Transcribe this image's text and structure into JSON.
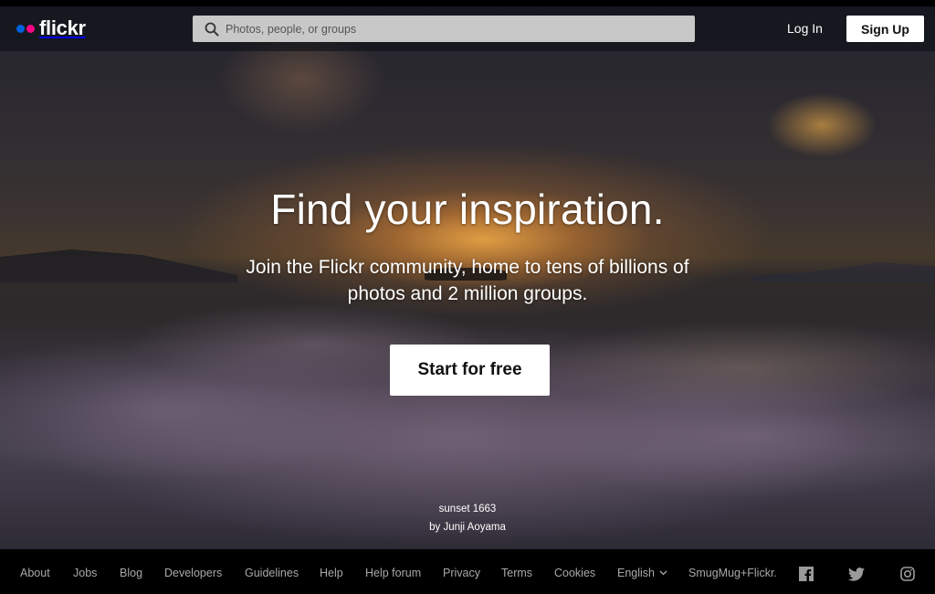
{
  "brand": {
    "name": "flickr",
    "dot_colors": [
      "#0063dc",
      "#ff0084"
    ]
  },
  "header": {
    "search_placeholder": "Photos, people, or groups",
    "search_icon": "search-icon",
    "login_label": "Log In",
    "signup_label": "Sign Up"
  },
  "hero": {
    "headline": "Find your inspiration.",
    "subline_1": "Join the Flickr community, home to tens of billions of",
    "subline_2": "photos and 2 million groups.",
    "cta_label": "Start for free",
    "photo_title": "sunset 1663",
    "photo_author": "by Junji Aoyama"
  },
  "footer": {
    "links": [
      "About",
      "Jobs",
      "Blog",
      "Developers",
      "Guidelines",
      "Help",
      "Help forum",
      "Privacy",
      "Terms",
      "Cookies"
    ],
    "language": "English",
    "language_icon": "chevron-down-icon",
    "smugmug": "SmugMug+Flickr.",
    "social": [
      "facebook-icon",
      "twitter-icon",
      "instagram-icon"
    ]
  }
}
